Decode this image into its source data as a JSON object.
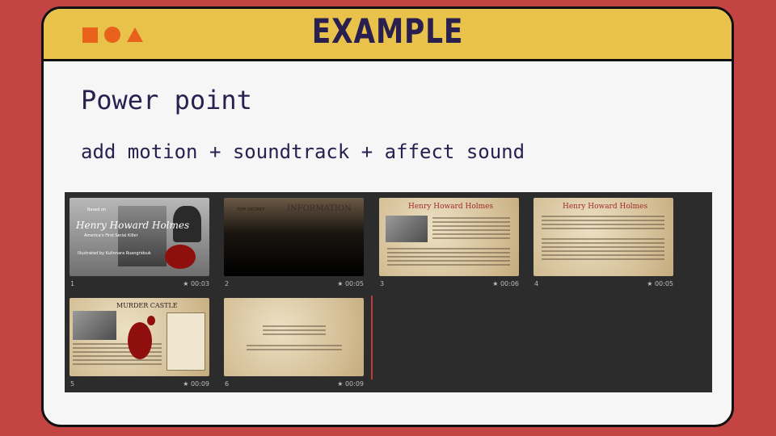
{
  "header": {
    "title": "EXAMPLE"
  },
  "heading": "Power point",
  "subheading": "add motion + soundtrack + affect sound",
  "slides": [
    {
      "number": "1",
      "duration": "00:03",
      "title": "Henry Howard Holmes",
      "subtitle": "America's First Serial Killer",
      "credit": "Illustrated by Kulinnara Ruangridsuk",
      "top_label": "Based on"
    },
    {
      "number": "2",
      "duration": "00:05",
      "title": "INFORMATION",
      "tag": "TOP SECRET"
    },
    {
      "number": "3",
      "duration": "00:06",
      "title": "Henry Howard Holmes"
    },
    {
      "number": "4",
      "duration": "00:05",
      "title": "Henry Howard Holmes"
    },
    {
      "number": "5",
      "duration": "00:09",
      "title": "MURDER CASTLE"
    },
    {
      "number": "6",
      "duration": "00:09"
    }
  ],
  "colors": {
    "background": "#c44444",
    "header": "#e9c24b",
    "text": "#2a2050",
    "shapes": "#e8621c",
    "sorter": "#2c2c2c"
  }
}
